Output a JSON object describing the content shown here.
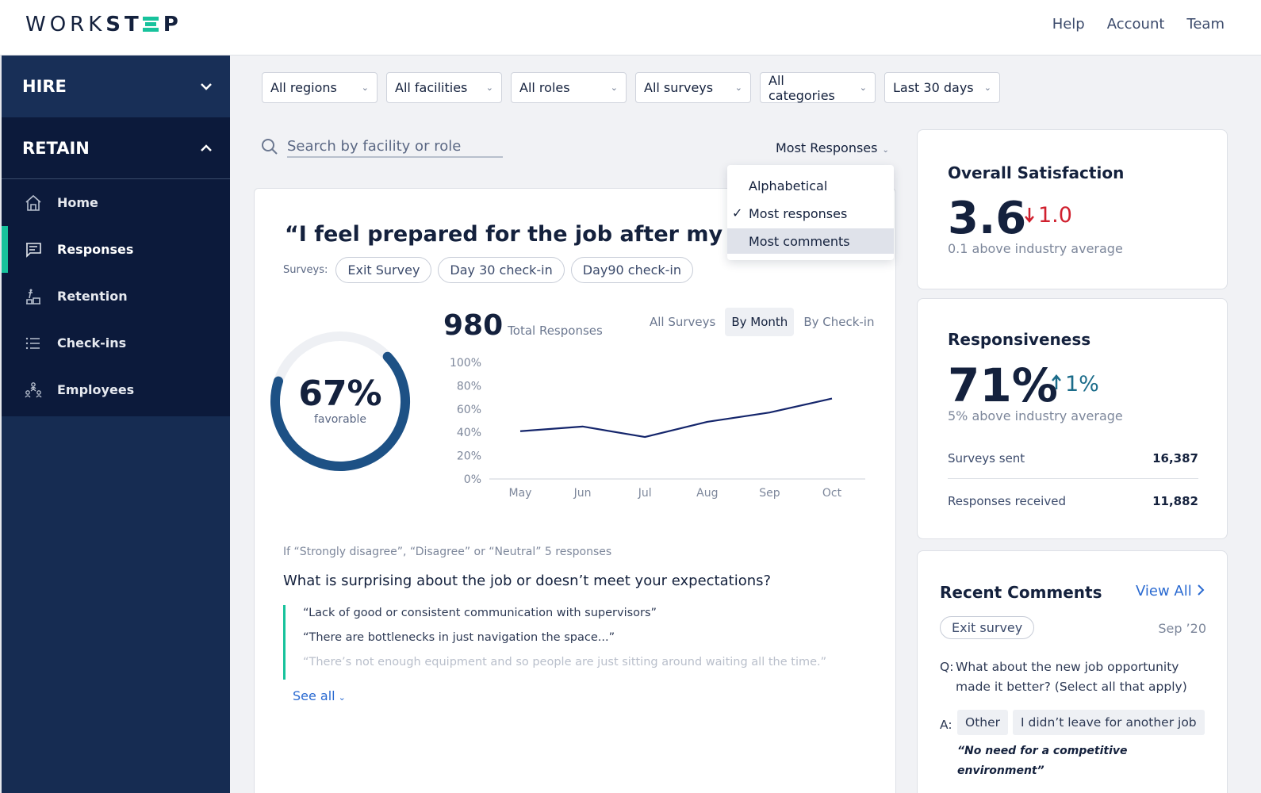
{
  "header": {
    "logo_text_thin": "WORK",
    "logo_text_bold_1": "ST",
    "logo_text_bold_2": "P",
    "nav": [
      "Help",
      "Account",
      "Team"
    ]
  },
  "sidebar": {
    "sections": [
      {
        "label": "HIRE",
        "expanded": false,
        "chevron": "chevron-down-icon"
      },
      {
        "label": "RETAIN",
        "expanded": true,
        "chevron": "chevron-up-icon"
      }
    ],
    "items": [
      {
        "label": "Home",
        "icon": "home-icon",
        "active": false
      },
      {
        "label": "Responses",
        "icon": "chat-icon",
        "active": true
      },
      {
        "label": "Retention",
        "icon": "retention-icon",
        "active": false
      },
      {
        "label": "Check-ins",
        "icon": "list-icon",
        "active": false
      },
      {
        "label": "Employees",
        "icon": "org-icon",
        "active": false
      }
    ],
    "accent_color": "#17c29c"
  },
  "filters": [
    {
      "label": "All regions"
    },
    {
      "label": "All facilities"
    },
    {
      "label": "All roles"
    },
    {
      "label": "All surveys"
    },
    {
      "label": "All categories"
    },
    {
      "label": "Last 30 days"
    }
  ],
  "search": {
    "placeholder": "Search by facility or role",
    "value": ""
  },
  "sort": {
    "selected": "Most Responses",
    "options": [
      {
        "label": "Alphabetical",
        "checked": false,
        "hover": false
      },
      {
        "label": "Most responses",
        "checked": true,
        "hover": false
      },
      {
        "label": "Most comments",
        "checked": false,
        "hover": true
      }
    ],
    "check_glyph": "✓"
  },
  "question_card": {
    "title": "“I feel prepared for the job after my first week”",
    "surveys_label": "Surveys:",
    "surveys": [
      "Exit Survey",
      "Day 30 check-in",
      "Day90 check-in"
    ],
    "favorable_pct": "67%",
    "favorable_value": 0.67,
    "favorable_label": "favorable",
    "total_responses": "980",
    "total_label": "Total Responses",
    "tabs": [
      {
        "label": "All Surveys",
        "active": false
      },
      {
        "label": "By Month",
        "active": true
      },
      {
        "label": "By Check-in",
        "active": false
      }
    ],
    "condition": "If “Strongly disagree”, “Disagree” or “Neutral” 5 responses",
    "followup_question": "What is surprising about the job or doesn’t meet your expectations?",
    "quotes": [
      "“Lack of good or consistent communication with supervisors”",
      "“There are bottlenecks in just navigation the space...”",
      "“There’s not enough equipment and so people are just sitting around waiting all the time.”"
    ],
    "see_all": "See all"
  },
  "chart_data": {
    "type": "line",
    "title": "",
    "xlabel": "",
    "ylabel": "",
    "categories": [
      "May",
      "Jun",
      "Jul",
      "Aug",
      "Sep",
      "Oct"
    ],
    "series": [
      {
        "name": "Favorable",
        "values": [
          41,
          45,
          36,
          49,
          57,
          69
        ]
      }
    ],
    "y_ticks": [
      "0%",
      "20%",
      "40%",
      "60%",
      "80%",
      "100%"
    ],
    "ylim": [
      0,
      100
    ],
    "grid": false,
    "line_color": "#14256b"
  },
  "satisfaction": {
    "title": "Overall Satisfaction",
    "value": "3.6",
    "delta": "1.0",
    "delta_direction": "down",
    "subtitle": "0.1 above industry average",
    "delta_color": "#d0202e"
  },
  "responsiveness": {
    "title": "Responsiveness",
    "value": "71%",
    "delta": "1%",
    "delta_direction": "up",
    "subtitle": "5% above industry average",
    "stats": [
      {
        "label": "Surveys sent",
        "value": "16,387"
      },
      {
        "label": "Responses received",
        "value": "11,882"
      }
    ]
  },
  "recent_comments": {
    "title": "Recent Comments",
    "view_all": "View All",
    "survey_tag": "Exit survey",
    "date": "Sep ’20",
    "q_prefix": "Q:",
    "question": "What about the new job opportunity made it better? (Select all that apply)",
    "a_prefix": "A:",
    "answers": [
      "Other",
      "I didn’t leave for another job"
    ],
    "comment": "“No need for a competitive environment”"
  }
}
